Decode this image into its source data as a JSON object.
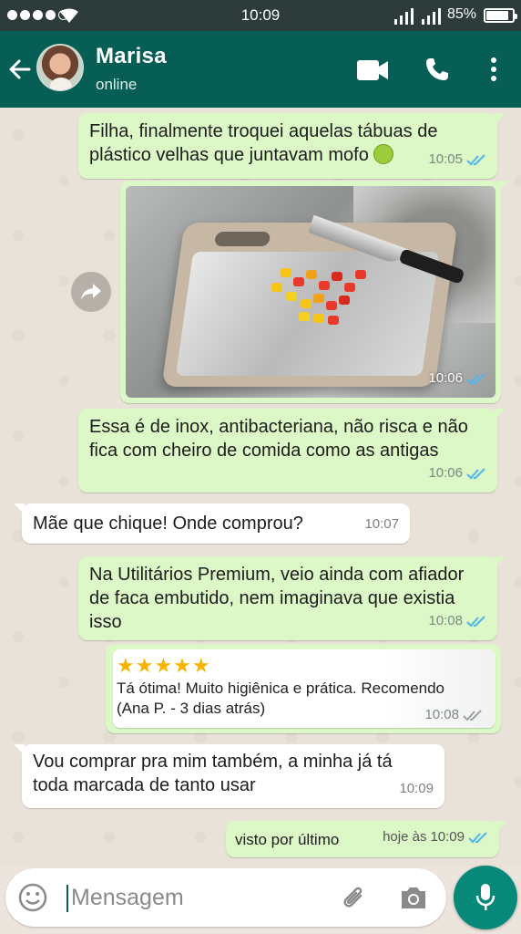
{
  "status_bar": {
    "time": "10:09",
    "battery": "85%",
    "battery_level": 0.85
  },
  "header": {
    "contact_name": "Marisa",
    "contact_status": "online"
  },
  "messages": [
    {
      "direction": "out",
      "text": "Filha, finalmente troquei aquelas tábuas de plástico velhas que juntavam mofo",
      "emoji": "nauseated-face-icon",
      "time": "10:05",
      "status": "read"
    },
    {
      "direction": "out",
      "type": "image",
      "image_desc": "stainless-cutting-board-photo",
      "time": "10:06",
      "status": "read"
    },
    {
      "direction": "out",
      "text": "Essa é de inox, antibacteriana, não risca e não fica com cheiro de comida como as antigas",
      "time": "10:06",
      "status": "read"
    },
    {
      "direction": "in",
      "text": "Mãe que chique! Onde comprou?",
      "time": "10:07"
    },
    {
      "direction": "out",
      "text": "Na Utilitários Premium, veio ainda com afiador de faca embutido, nem imaginava que existia isso",
      "time": "10:08",
      "status": "read"
    },
    {
      "direction": "out",
      "type": "review",
      "stars": "★★★★★",
      "rating": 5,
      "review_text": "Tá ótima! Muito higiênica e prática. Recomendo",
      "review_author": "(Ana P. - 3 dias atrás)",
      "time": "10:08",
      "status": "delivered"
    },
    {
      "direction": "in",
      "text": "Vou comprar pra mim também, a minha já tá toda marcada de tanto usar",
      "time": "10:09"
    },
    {
      "direction": "out",
      "text": "visto por último",
      "time_prefix": "hoje às",
      "time": "10:09",
      "status": "read"
    }
  ],
  "input": {
    "placeholder": "Mensagem"
  },
  "colors": {
    "header": "#075e54",
    "status_bar": "#2d3b3a",
    "outgoing": "#dcf8c6",
    "incoming": "#ffffff",
    "read_ticks": "#4fb6ec",
    "mic_button": "#07897a"
  }
}
